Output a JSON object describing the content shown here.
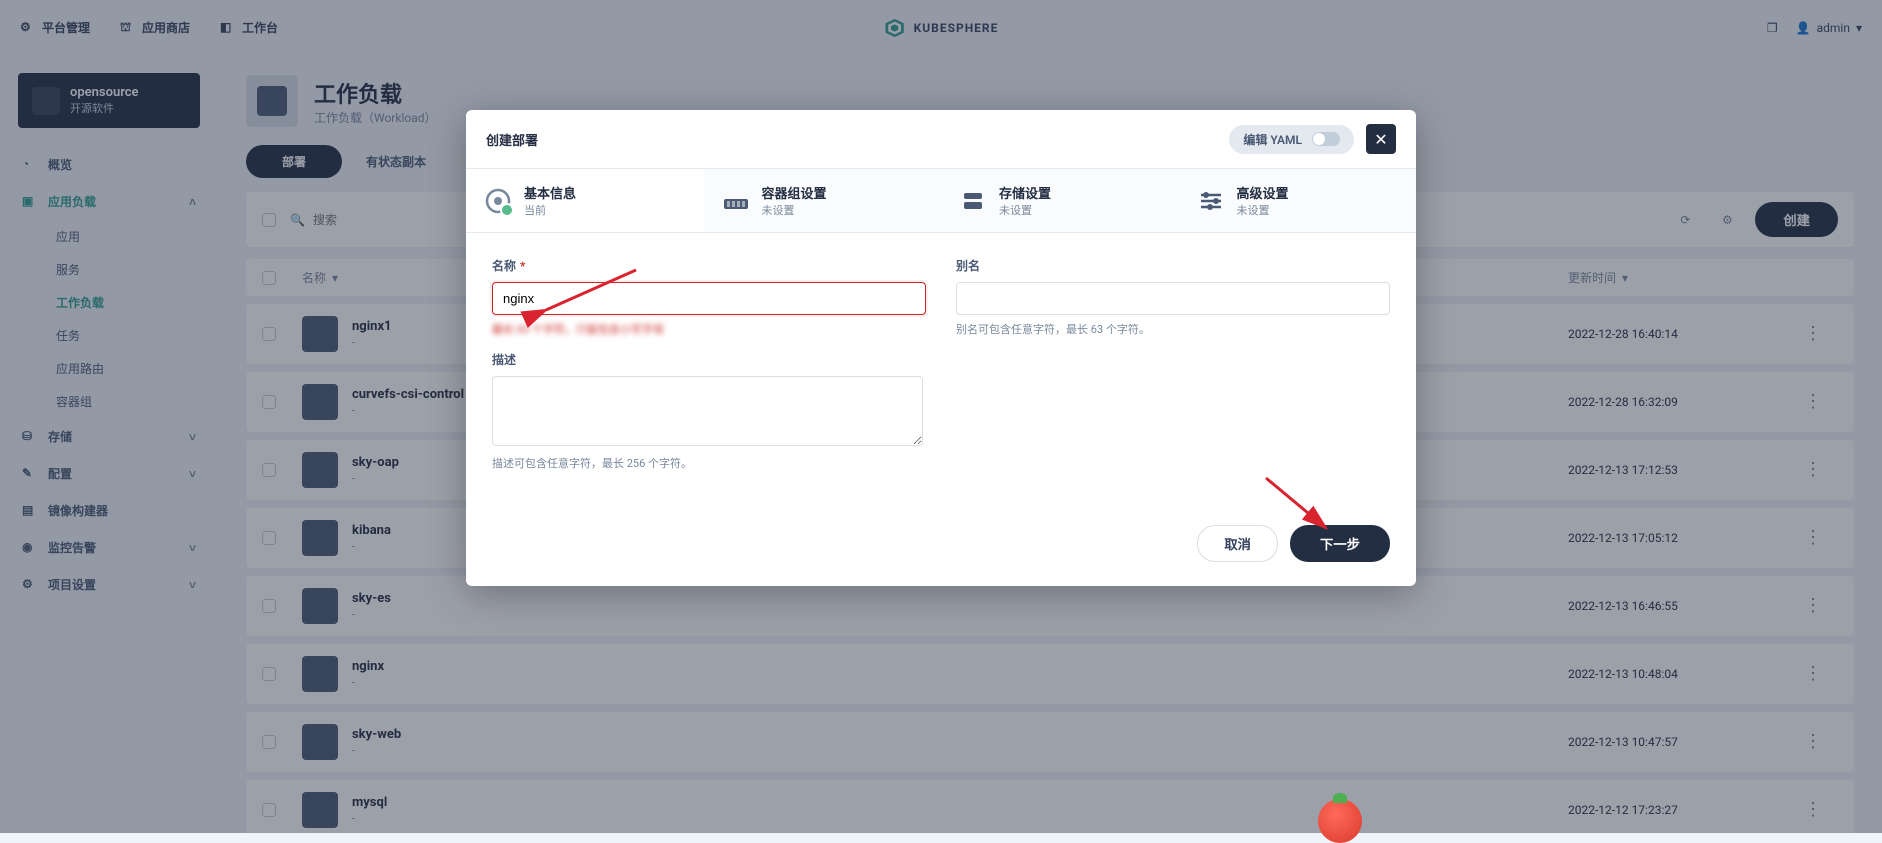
{
  "topbar": {
    "links": [
      "平台管理",
      "应用商店",
      "工作台"
    ],
    "brand": "KUBESPHERE",
    "user": "admin"
  },
  "project": {
    "name": "opensource",
    "sub": "开源软件"
  },
  "sidebar": {
    "overview": "概览",
    "workloads": "应用负载",
    "items": [
      "应用",
      "服务",
      "工作负载",
      "任务",
      "应用路由",
      "容器组"
    ],
    "active_index": 2,
    "storage": "存储",
    "config": "配置",
    "image_builder": "镜像构建器",
    "monitor": "监控告警",
    "project_settings": "项目设置"
  },
  "page": {
    "title": "工作负载",
    "subtitle": "工作负载（Workload）"
  },
  "tabs": {
    "active": "部署",
    "others": [
      "有状态副本"
    ]
  },
  "toolbar": {
    "search_placeholder": "搜索",
    "create": "创建"
  },
  "table": {
    "col_name": "名称",
    "col_time": "更新时间",
    "rows": [
      {
        "name": "nginx1",
        "sub": "-",
        "time": "2022-12-28 16:40:14"
      },
      {
        "name": "curvefs-csi-control",
        "sub": "-",
        "time": "2022-12-28 16:32:09"
      },
      {
        "name": "sky-oap",
        "sub": "-",
        "time": "2022-12-13 17:12:53"
      },
      {
        "name": "kibana",
        "sub": "-",
        "time": "2022-12-13 17:05:12"
      },
      {
        "name": "sky-es",
        "sub": "-",
        "time": "2022-12-13 16:46:55"
      },
      {
        "name": "nginx",
        "sub": "-",
        "time": "2022-12-13 10:48:04"
      },
      {
        "name": "sky-web",
        "sub": "-",
        "time": "2022-12-13 10:47:57"
      },
      {
        "name": "mysql",
        "sub": "-",
        "time": "2022-12-12 17:23:27"
      }
    ]
  },
  "modal": {
    "title": "创建部署",
    "yaml_label": "编辑 YAML",
    "steps": [
      {
        "title": "基本信息",
        "sub": "当前"
      },
      {
        "title": "容器组设置",
        "sub": "未设置"
      },
      {
        "title": "存储设置",
        "sub": "未设置"
      },
      {
        "title": "高级设置",
        "sub": "未设置"
      }
    ],
    "form": {
      "name_label": "名称",
      "name_value": "nginx",
      "name_hint": "",
      "alias_label": "别名",
      "alias_hint": "别名可包含任意字符，最长 63 个字符。",
      "desc_label": "描述",
      "desc_hint": "描述可包含任意字符，最长 256 个字符。"
    },
    "footer": {
      "cancel": "取消",
      "next": "下一步"
    }
  }
}
